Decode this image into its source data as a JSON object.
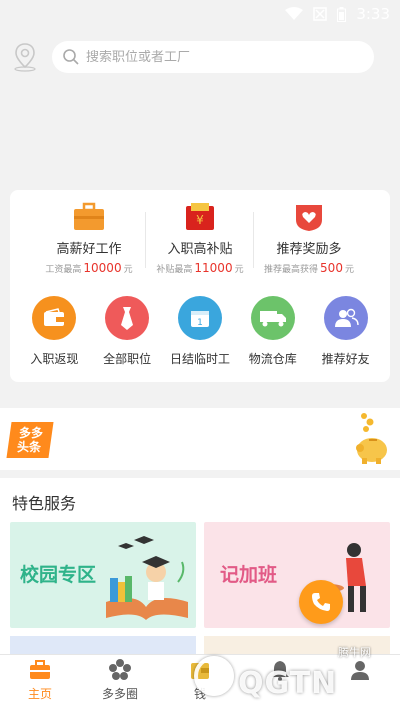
{
  "status_bar": {
    "time": "3:33"
  },
  "search": {
    "placeholder": "搜索职位或者工厂"
  },
  "promos": [
    {
      "title": "高薪好工作",
      "sub_prefix": "工资最高",
      "amount": "10000",
      "unit": "元",
      "icon": "briefcase-icon",
      "color": "#f39a2e"
    },
    {
      "title": "入职高补贴",
      "sub_prefix": "补贴最高",
      "amount": "11000",
      "unit": "元",
      "icon": "red-envelope-icon",
      "color": "#d9231d"
    },
    {
      "title": "推荐奖励多",
      "sub_prefix": "推荐最高获得",
      "amount": "500",
      "unit": "元",
      "icon": "heart-badge-icon",
      "color": "#e8483c"
    }
  ],
  "categories": [
    {
      "label": "入职返现",
      "icon": "wallet-icon",
      "color": "#f6911e"
    },
    {
      "label": "全部职位",
      "icon": "tie-icon",
      "color": "#ef5a5a"
    },
    {
      "label": "日结临时工",
      "icon": "calendar-icon",
      "color": "#3aa6dd"
    },
    {
      "label": "物流仓库",
      "icon": "truck-icon",
      "color": "#6cc36a"
    },
    {
      "label": "推荐好友",
      "icon": "friends-icon",
      "color": "#7b86e0"
    }
  ],
  "news": {
    "logo_line1": "多多",
    "logo_line2": "头条"
  },
  "features": {
    "title": "特色服务",
    "tiles": [
      {
        "label": "校园专区"
      },
      {
        "label": "记加班"
      }
    ]
  },
  "tabs": [
    {
      "label": "主页",
      "icon": "home-briefcase-icon",
      "active": true
    },
    {
      "label": "多多圈",
      "icon": "flower-icon",
      "active": false
    },
    {
      "label": "钱",
      "icon": "wallet-tab-icon",
      "active": false
    },
    {
      "label": "",
      "icon": "bell-icon",
      "active": false
    },
    {
      "label": "",
      "icon": "profile-icon",
      "active": false
    }
  ],
  "watermark": {
    "text": "QGTN",
    "sub": "腾牛网"
  },
  "colors": {
    "accent": "#ff8a1c",
    "highlight": "#e8342c"
  }
}
